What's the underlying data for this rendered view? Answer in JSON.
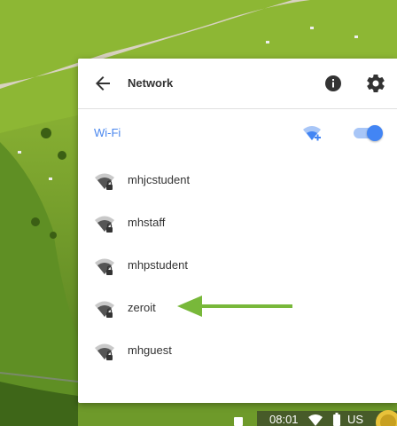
{
  "panel": {
    "title": "Network",
    "back_icon": "arrow-back-icon",
    "info_icon": "info-icon",
    "settings_icon": "gear-icon"
  },
  "wifi": {
    "label": "Wi-Fi",
    "add_icon": "wifi-add-icon",
    "enabled": true,
    "accent_color": "#4285f4"
  },
  "networks": [
    {
      "name": "mhjcstudent",
      "icon": "wifi-secure-icon"
    },
    {
      "name": "mhstaff",
      "icon": "wifi-secure-icon"
    },
    {
      "name": "mhpstudent",
      "icon": "wifi-secure-icon"
    },
    {
      "name": "zeroit",
      "icon": "wifi-secure-icon"
    },
    {
      "name": "mhguest",
      "icon": "wifi-secure-icon"
    }
  ],
  "annotation": {
    "arrow_color": "#78b83a",
    "points_to": "zeroit"
  },
  "shelf": {
    "time": "08:01",
    "ime": "US"
  }
}
